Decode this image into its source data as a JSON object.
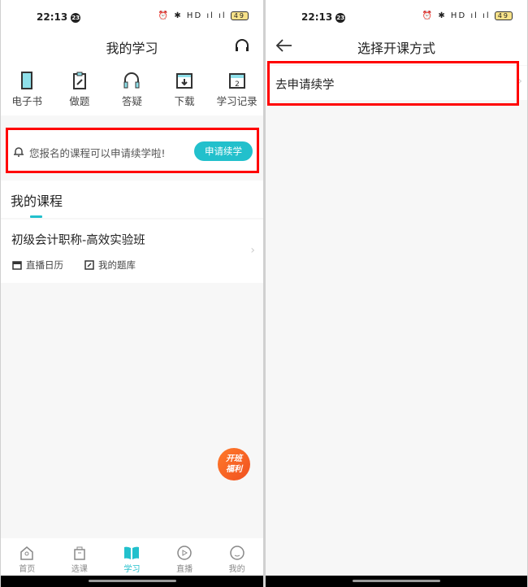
{
  "status": {
    "time": "22:13",
    "badge": "23",
    "battery": "49",
    "signal": "⏰ ✱ HD ıl ıl"
  },
  "left": {
    "title": "我的学习",
    "quick": [
      {
        "label": "电子书",
        "icon": "ebook-icon"
      },
      {
        "label": "做题",
        "icon": "clipboard-icon"
      },
      {
        "label": "答疑",
        "icon": "headphones-icon"
      },
      {
        "label": "下载",
        "icon": "download-folder-icon"
      },
      {
        "label": "学习记录",
        "icon": "calendar-icon"
      }
    ],
    "banner": {
      "text": "您报名的课程可以申请续学啦!",
      "button": "申请续学"
    },
    "section_title": "我的课程",
    "course": {
      "name": "初级会计职称-高效实验班",
      "links": [
        "直播日历",
        "我的题库"
      ]
    },
    "float": {
      "line1": "开班",
      "line2": "福利"
    },
    "nav": [
      {
        "label": "首页"
      },
      {
        "label": "选课"
      },
      {
        "label": "学习"
      },
      {
        "label": "直播"
      },
      {
        "label": "我的"
      }
    ]
  },
  "right": {
    "title": "选择开课方式",
    "item": "去申请续学"
  },
  "colors": {
    "accent": "#22c0cc",
    "highlight": "#ff0000"
  }
}
